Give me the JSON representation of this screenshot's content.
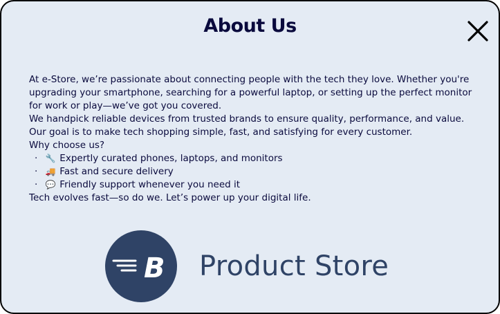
{
  "dialog": {
    "title": "About Us",
    "close_icon": "close-icon"
  },
  "content": {
    "paragraphs": [
      "At e-Store, we’re passionate about connecting people with the tech they love. Whether you're",
      "upgrading your smartphone, searching for a powerful laptop, or setting up the perfect monitor",
      "for work or play—we’ve got you covered.",
      "We handpick reliable devices from trusted brands to ensure quality, performance, and value.",
      "Our goal is to make tech shopping simple, fast, and satisfying for every customer.",
      "Why choose us?"
    ],
    "bullets": [
      {
        "icon": "🔧",
        "icon_name": "wrench-icon",
        "text": "Expertly curated phones, laptops, and monitors"
      },
      {
        "icon": "🚚",
        "icon_name": "delivery-truck-icon",
        "text": "Fast and secure delivery"
      },
      {
        "icon": "💬",
        "icon_name": "speech-bubble-icon",
        "text": "Friendly support whenever you need it"
      }
    ],
    "closing": "Tech evolves fast—so do we. Let’s power up your digital life."
  },
  "brand": {
    "name": "Product Store",
    "logo_letter": "B",
    "color": "#2f4366"
  },
  "colors": {
    "background": "#e4ebf4",
    "text": "#0a0a3d",
    "border": "#000000"
  }
}
